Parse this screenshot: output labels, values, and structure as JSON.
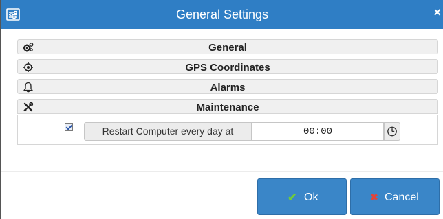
{
  "window": {
    "title": "General Settings",
    "close_glyph": "×"
  },
  "sections": [
    {
      "label": "General",
      "icon": "gears-icon"
    },
    {
      "label": "GPS Coordinates",
      "icon": "crosshair-icon"
    },
    {
      "label": "Alarms",
      "icon": "bell-icon"
    },
    {
      "label": "Maintenance",
      "icon": "tools-icon",
      "expanded": true
    }
  ],
  "maintenance": {
    "restart_label": "Restart Computer every day at",
    "restart_checked": true,
    "time_value": "00:00",
    "clock_icon": "clock-icon"
  },
  "buttons": {
    "ok_label": "Ok",
    "ok_glyph": "✔",
    "cancel_label": "Cancel",
    "cancel_glyph": "✖"
  },
  "colors": {
    "titlebar": "#2f7ec5",
    "button": "#3a86c8",
    "ok_check": "#6fcb3b",
    "cancel_x": "#e0453b"
  }
}
